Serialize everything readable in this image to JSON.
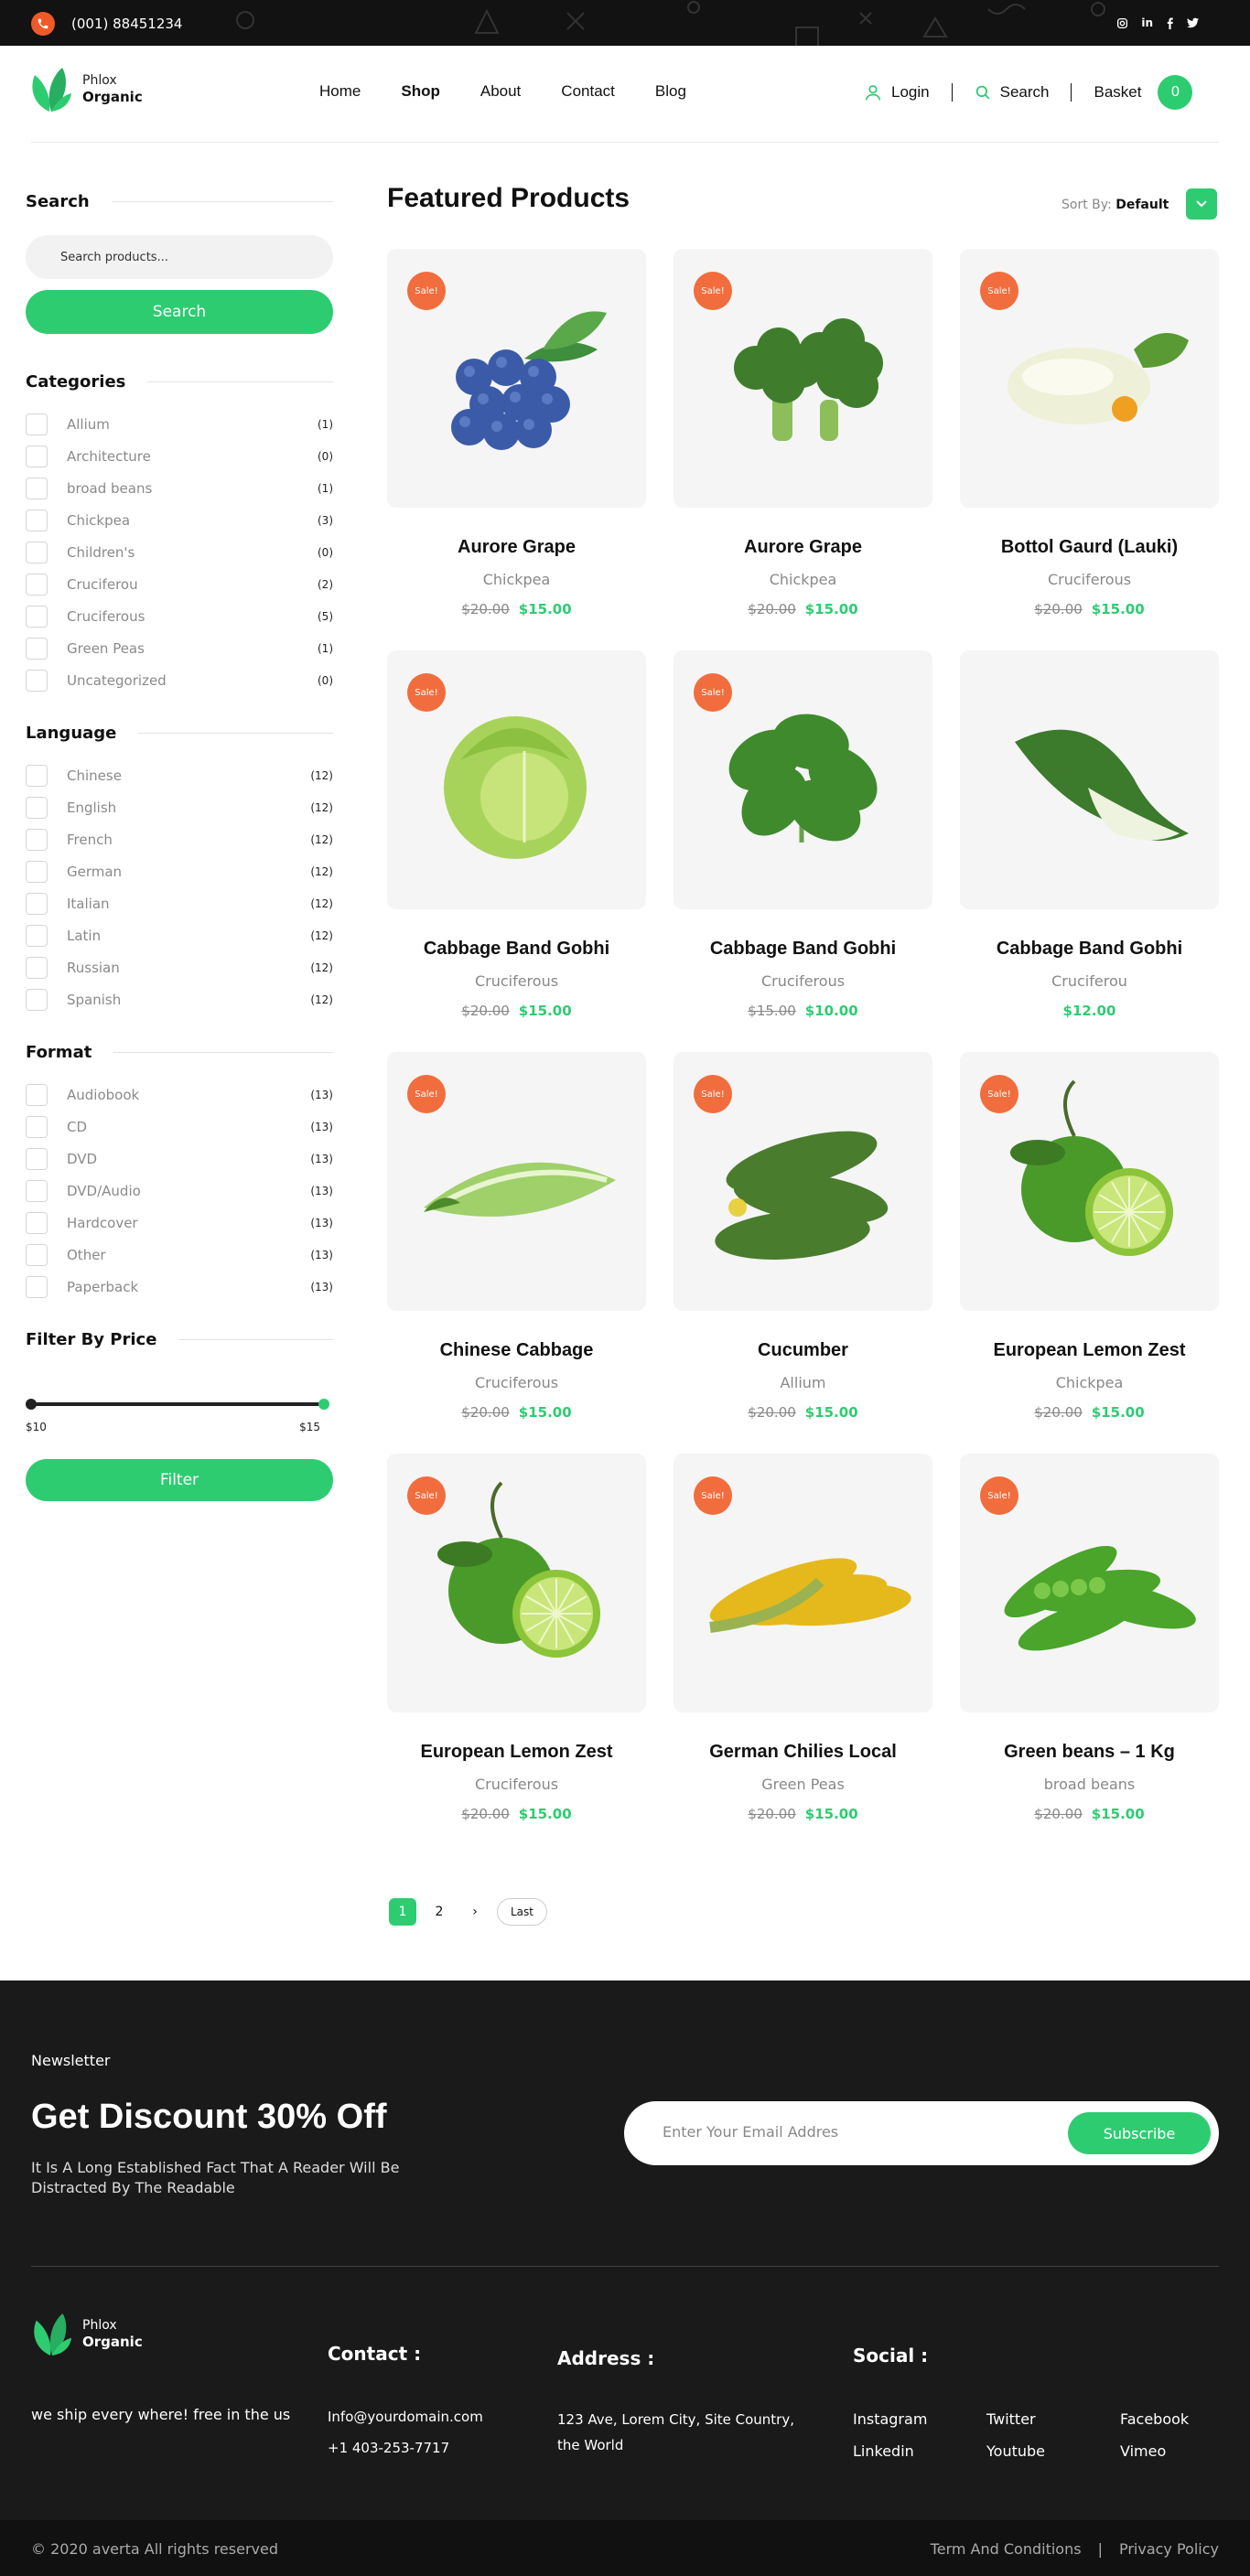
{
  "topbar": {
    "phone": "(001) 88451234",
    "socials": [
      "instagram-icon",
      "linkedin-icon",
      "facebook-icon",
      "twitter-icon"
    ],
    "linkedin_label": "in"
  },
  "brand": {
    "line1": "Phlox",
    "line2": "Organic"
  },
  "nav": {
    "items": [
      "Home",
      "Shop",
      "About",
      "Contact",
      "Blog"
    ],
    "active": "Shop"
  },
  "header": {
    "login": "Login",
    "search": "Search",
    "basket": "Basket",
    "basket_count": "0"
  },
  "sidebar": {
    "search_title": "Search",
    "search_placeholder": "Search products...",
    "search_button": "Search",
    "categories_title": "Categories",
    "categories": [
      {
        "label": "Allium",
        "count": "(1)"
      },
      {
        "label": "Architecture",
        "count": "(0)"
      },
      {
        "label": "broad beans",
        "count": "(1)"
      },
      {
        "label": "Chickpea",
        "count": "(3)"
      },
      {
        "label": "Children's",
        "count": "(0)"
      },
      {
        "label": "Cruciferou",
        "count": "(2)"
      },
      {
        "label": "Cruciferous",
        "count": "(5)"
      },
      {
        "label": "Green Peas",
        "count": "(1)"
      },
      {
        "label": "Uncategorized",
        "count": "(0)"
      }
    ],
    "language_title": "Language",
    "languages": [
      {
        "label": "Chinese",
        "count": "(12)"
      },
      {
        "label": "English",
        "count": "(12)"
      },
      {
        "label": "French",
        "count": "(12)"
      },
      {
        "label": "German",
        "count": "(12)"
      },
      {
        "label": "Italian",
        "count": "(12)"
      },
      {
        "label": "Latin",
        "count": "(12)"
      },
      {
        "label": "Russian",
        "count": "(12)"
      },
      {
        "label": "Spanish",
        "count": "(12)"
      }
    ],
    "format_title": "Format",
    "formats": [
      {
        "label": "Audiobook",
        "count": "(13)"
      },
      {
        "label": "CD",
        "count": "(13)"
      },
      {
        "label": "DVD",
        "count": "(13)"
      },
      {
        "label": "DVD/Audio",
        "count": "(13)"
      },
      {
        "label": "Hardcover",
        "count": "(13)"
      },
      {
        "label": "Other",
        "count": "(13)"
      },
      {
        "label": "Paperback",
        "count": "(13)"
      }
    ],
    "price_title": "Filter By Price",
    "price_min": "$10",
    "price_max": "$15",
    "filter_button": "Filter"
  },
  "main": {
    "title": "Featured Products",
    "sort_label": "Sort By:",
    "sort_value": "Default",
    "sale_label": "Sale!",
    "products": [
      {
        "name": "Aurore Grape",
        "category": "Chickpea",
        "old_price": "$20.00",
        "price": "$15.00",
        "sale": true,
        "icon": "blueberries"
      },
      {
        "name": "Aurore Grape",
        "category": "Chickpea",
        "old_price": "$20.00",
        "price": "$15.00",
        "sale": true,
        "icon": "broccoli"
      },
      {
        "name": "Bottol Gaurd (Lauki)",
        "category": "Cruciferous",
        "old_price": "$20.00",
        "price": "$15.00",
        "sale": true,
        "icon": "zucchini"
      },
      {
        "name": "Cabbage Band Gobhi",
        "category": "Cruciferous",
        "old_price": "$20.00",
        "price": "$15.00",
        "sale": true,
        "icon": "cabbage"
      },
      {
        "name": "Cabbage Band Gobhi",
        "category": "Cruciferous",
        "old_price": "$15.00",
        "price": "$10.00",
        "sale": true,
        "icon": "spinach"
      },
      {
        "name": "Cabbage Band Gobhi",
        "category": "Cruciferou",
        "old_price": "",
        "price": "$12.00",
        "sale": false,
        "icon": "bokchoy"
      },
      {
        "name": "Chinese Cabbage",
        "category": "Cruciferous",
        "old_price": "$20.00",
        "price": "$15.00",
        "sale": true,
        "icon": "chinese-cabbage"
      },
      {
        "name": "Cucumber",
        "category": "Allium",
        "old_price": "$20.00",
        "price": "$15.00",
        "sale": true,
        "icon": "cucumber"
      },
      {
        "name": "European Lemon Zest",
        "category": "Chickpea",
        "old_price": "$20.00",
        "price": "$15.00",
        "sale": true,
        "icon": "lime"
      },
      {
        "name": "European Lemon Zest",
        "category": "Cruciferous",
        "old_price": "$20.00",
        "price": "$15.00",
        "sale": true,
        "icon": "lime"
      },
      {
        "name": "German Chilies Local",
        "category": "Green Peas",
        "old_price": "$20.00",
        "price": "$15.00",
        "sale": true,
        "icon": "corn"
      },
      {
        "name": "Green beans – 1 Kg",
        "category": "broad beans",
        "old_price": "$20.00",
        "price": "$15.00",
        "sale": true,
        "icon": "peas"
      }
    ],
    "pagination": {
      "current": "1",
      "next_page": "2",
      "next_symbol": "›",
      "last": "Last"
    }
  },
  "footer": {
    "newsletter_label": "Newsletter",
    "newsletter_title": "Get Discount 30% Off",
    "newsletter_text": "It Is A Long Established Fact That A Reader Will Be Distracted By The Readable",
    "email_placeholder": "Enter Your Email Addres",
    "subscribe": "Subscribe",
    "tagline": "we ship every where! free in the us",
    "contact_title": "Contact :",
    "contact_email": "Info@yourdomain.com",
    "contact_phone": "+1 403-253-7717",
    "address_title": "Address :",
    "address": "123 Ave, Lorem City, Site Country, the World",
    "social_title": "Social :",
    "social_links": [
      "Instagram",
      "Twitter",
      "Facebook",
      "Linkedin",
      "Youtube",
      "Vimeo"
    ],
    "copyright": "© 2020 averta All rights reserved",
    "terms": "Term And Conditions",
    "privacy": "Privacy Policy",
    "legal_sep": "|"
  },
  "colors": {
    "accent": "#2ecc71",
    "sale": "#f26d3d",
    "dark": "#1a1a1a"
  }
}
